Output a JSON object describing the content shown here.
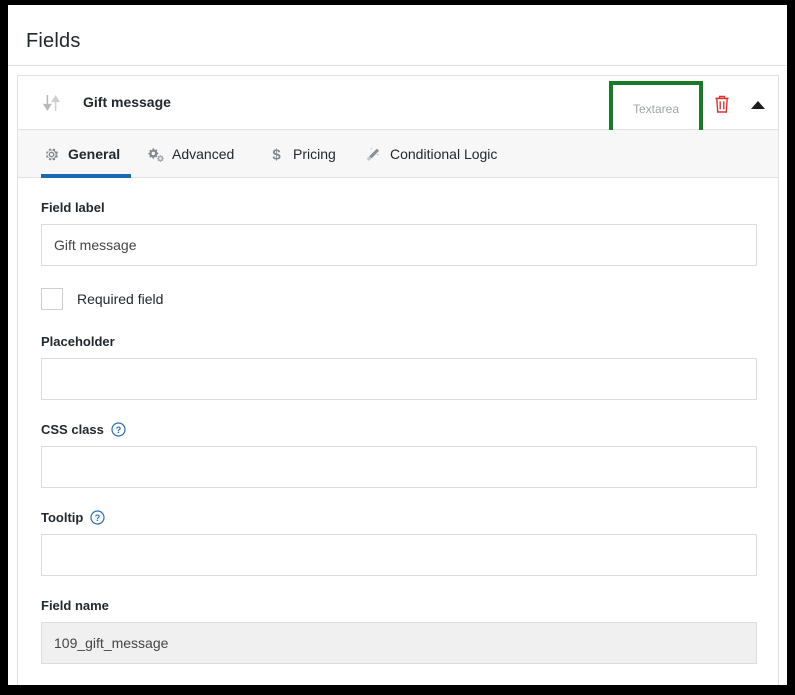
{
  "page": {
    "title": "Fields"
  },
  "field": {
    "header": {
      "drag_handle_icon": "sort-updown-icon",
      "title": "Gift message",
      "type_badge": "Textarea",
      "delete_icon": "trash-icon",
      "collapse_icon": "caret-up-icon",
      "highlight_color": "#1a7a28",
      "delete_icon_color": "#e03131"
    },
    "tabs": [
      {
        "label": "General",
        "icon": "gear-icon",
        "active": true
      },
      {
        "label": "Advanced",
        "icon": "gears-icon",
        "active": false
      },
      {
        "label": "Pricing",
        "icon": "dollar-icon",
        "active": false
      },
      {
        "label": "Conditional Logic",
        "icon": "magic-wand-icon",
        "active": false
      }
    ],
    "active_tab_color": "#1b68b3",
    "general": {
      "field_label": {
        "label": "Field label",
        "value": "Gift message",
        "placeholder": ""
      },
      "required_field": {
        "label": "Required field",
        "checked": false
      },
      "placeholder_field": {
        "label": "Placeholder",
        "value": "",
        "placeholder": ""
      },
      "css_class": {
        "label": "CSS class",
        "value": "",
        "placeholder": "",
        "help_icon": "question-circle-icon"
      },
      "tooltip": {
        "label": "Tooltip",
        "value": "",
        "placeholder": "",
        "help_icon": "question-circle-icon"
      },
      "field_name": {
        "label": "Field name",
        "value": "109_gift_message",
        "placeholder": "",
        "readonly": true
      }
    }
  }
}
